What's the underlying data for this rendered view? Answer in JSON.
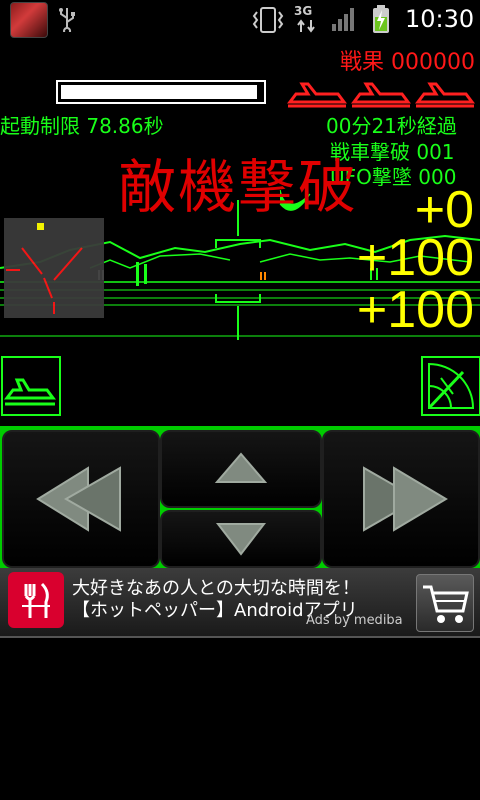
{
  "status_bar": {
    "clock": "10:30",
    "network_label": "3G",
    "icons": [
      "app-thumbnail-icon",
      "usb-icon",
      "vibrate-icon",
      "3g-data-icon",
      "signal-icon",
      "battery-charging-icon"
    ]
  },
  "hud": {
    "score_label": "戦果",
    "score_value": "000000",
    "energy_fraction": 0.98,
    "lives_remaining": 3,
    "time_limit": "起動制限 78.86秒",
    "elapsed": "00分21秒経過",
    "tank_kills": "戦車撃破 001",
    "ufo_kills": "UFO撃墜 000",
    "kill_message": "敵機撃破",
    "bonuses": [
      "+0",
      "+100",
      "+100"
    ]
  },
  "controls": {
    "side_left_icon": "tank-select-icon",
    "side_right_icon": "radar-sweep-icon",
    "left_icon": "rotate-left-icon",
    "up_icon": "forward-arrow-icon",
    "down_icon": "backward-arrow-icon",
    "right_icon": "rotate-right-icon"
  },
  "ad": {
    "line1": "大好きなあの人との大切な時間を！",
    "line2": "【ホットペッパー】Androidアプリ",
    "byline": "Ads by mediba",
    "app_icon": "restaurant-fork-icon",
    "cart_icon": "shopping-cart-icon"
  },
  "colors": {
    "hud_red": "#ff1818",
    "hud_green": "#19ff19",
    "hud_yellow": "#ffff00",
    "pad_green": "#00cc00"
  }
}
